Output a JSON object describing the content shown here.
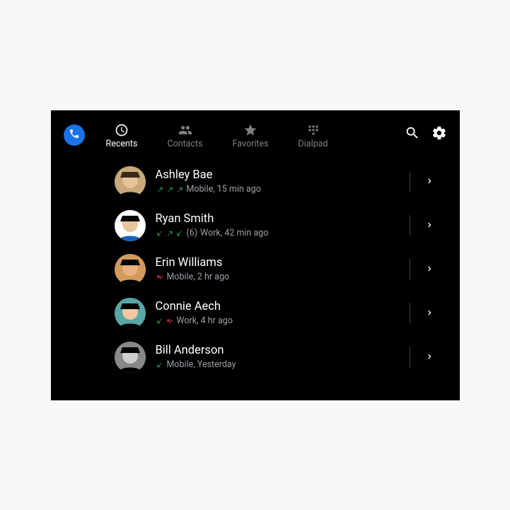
{
  "tabs": [
    {
      "label": "Recents",
      "icon": "recents-icon",
      "active": true
    },
    {
      "label": "Contacts",
      "icon": "contacts-icon",
      "active": false
    },
    {
      "label": "Favorites",
      "icon": "star-icon",
      "active": false
    },
    {
      "label": "Dialpad",
      "icon": "dialpad-icon",
      "active": false
    }
  ],
  "calls": [
    {
      "name": "Ashley Bae",
      "arrows": [
        "out",
        "out",
        "out"
      ],
      "count": null,
      "meta": "Mobile, 15 min ago",
      "avatar": "av1"
    },
    {
      "name": "Ryan Smith",
      "arrows": [
        "in",
        "out",
        "in"
      ],
      "count": "(6)",
      "meta": "Work, 42 min ago",
      "avatar": "av2"
    },
    {
      "name": "Erin Williams",
      "arrows": [
        "missed"
      ],
      "count": null,
      "meta": "Mobile, 2 hr ago",
      "avatar": "av3"
    },
    {
      "name": "Connie Aech",
      "arrows": [
        "in",
        "missed"
      ],
      "count": null,
      "meta": "Work, 4 hr ago",
      "avatar": "av4"
    },
    {
      "name": "Bill Anderson",
      "arrows": [
        "in"
      ],
      "count": null,
      "meta": "Mobile, Yesterday",
      "avatar": "av5"
    }
  ]
}
